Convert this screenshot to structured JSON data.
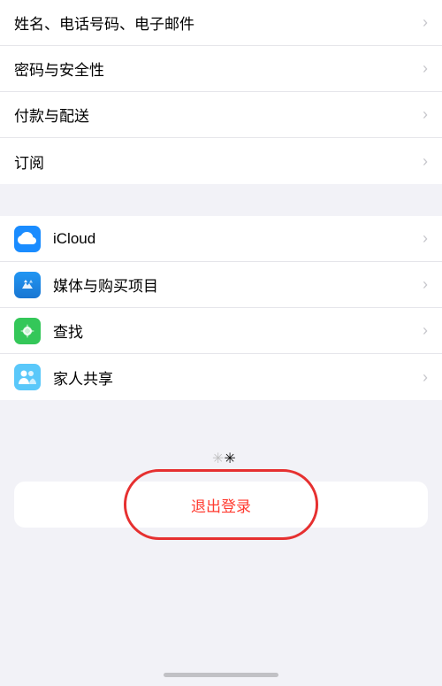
{
  "sections": {
    "section1": {
      "items": [
        {
          "id": "name-phone-email",
          "label": "姓名、电话号码、电子邮件",
          "hasIcon": false
        },
        {
          "id": "password-security",
          "label": "密码与安全性",
          "hasIcon": false
        },
        {
          "id": "payment-delivery",
          "label": "付款与配送",
          "hasIcon": false
        },
        {
          "id": "subscriptions",
          "label": "订阅",
          "hasIcon": false
        }
      ]
    },
    "section2": {
      "items": [
        {
          "id": "icloud",
          "label": "iCloud",
          "iconType": "icloud"
        },
        {
          "id": "media-purchase",
          "label": "媒体与购买项目",
          "iconType": "appstore"
        },
        {
          "id": "find",
          "label": "查找",
          "iconType": "find"
        },
        {
          "id": "family-sharing",
          "label": "家人共享",
          "iconType": "family"
        }
      ]
    }
  },
  "logout": {
    "label": "退出登录"
  },
  "chevron": ">",
  "colors": {
    "accent_red": "#ff3b30",
    "circle_red": "#e63030",
    "icloud_blue": "#1a8cff",
    "appstore_blue": "#0d84ff",
    "find_green": "#34c759",
    "family_blue": "#5ac8fa"
  }
}
